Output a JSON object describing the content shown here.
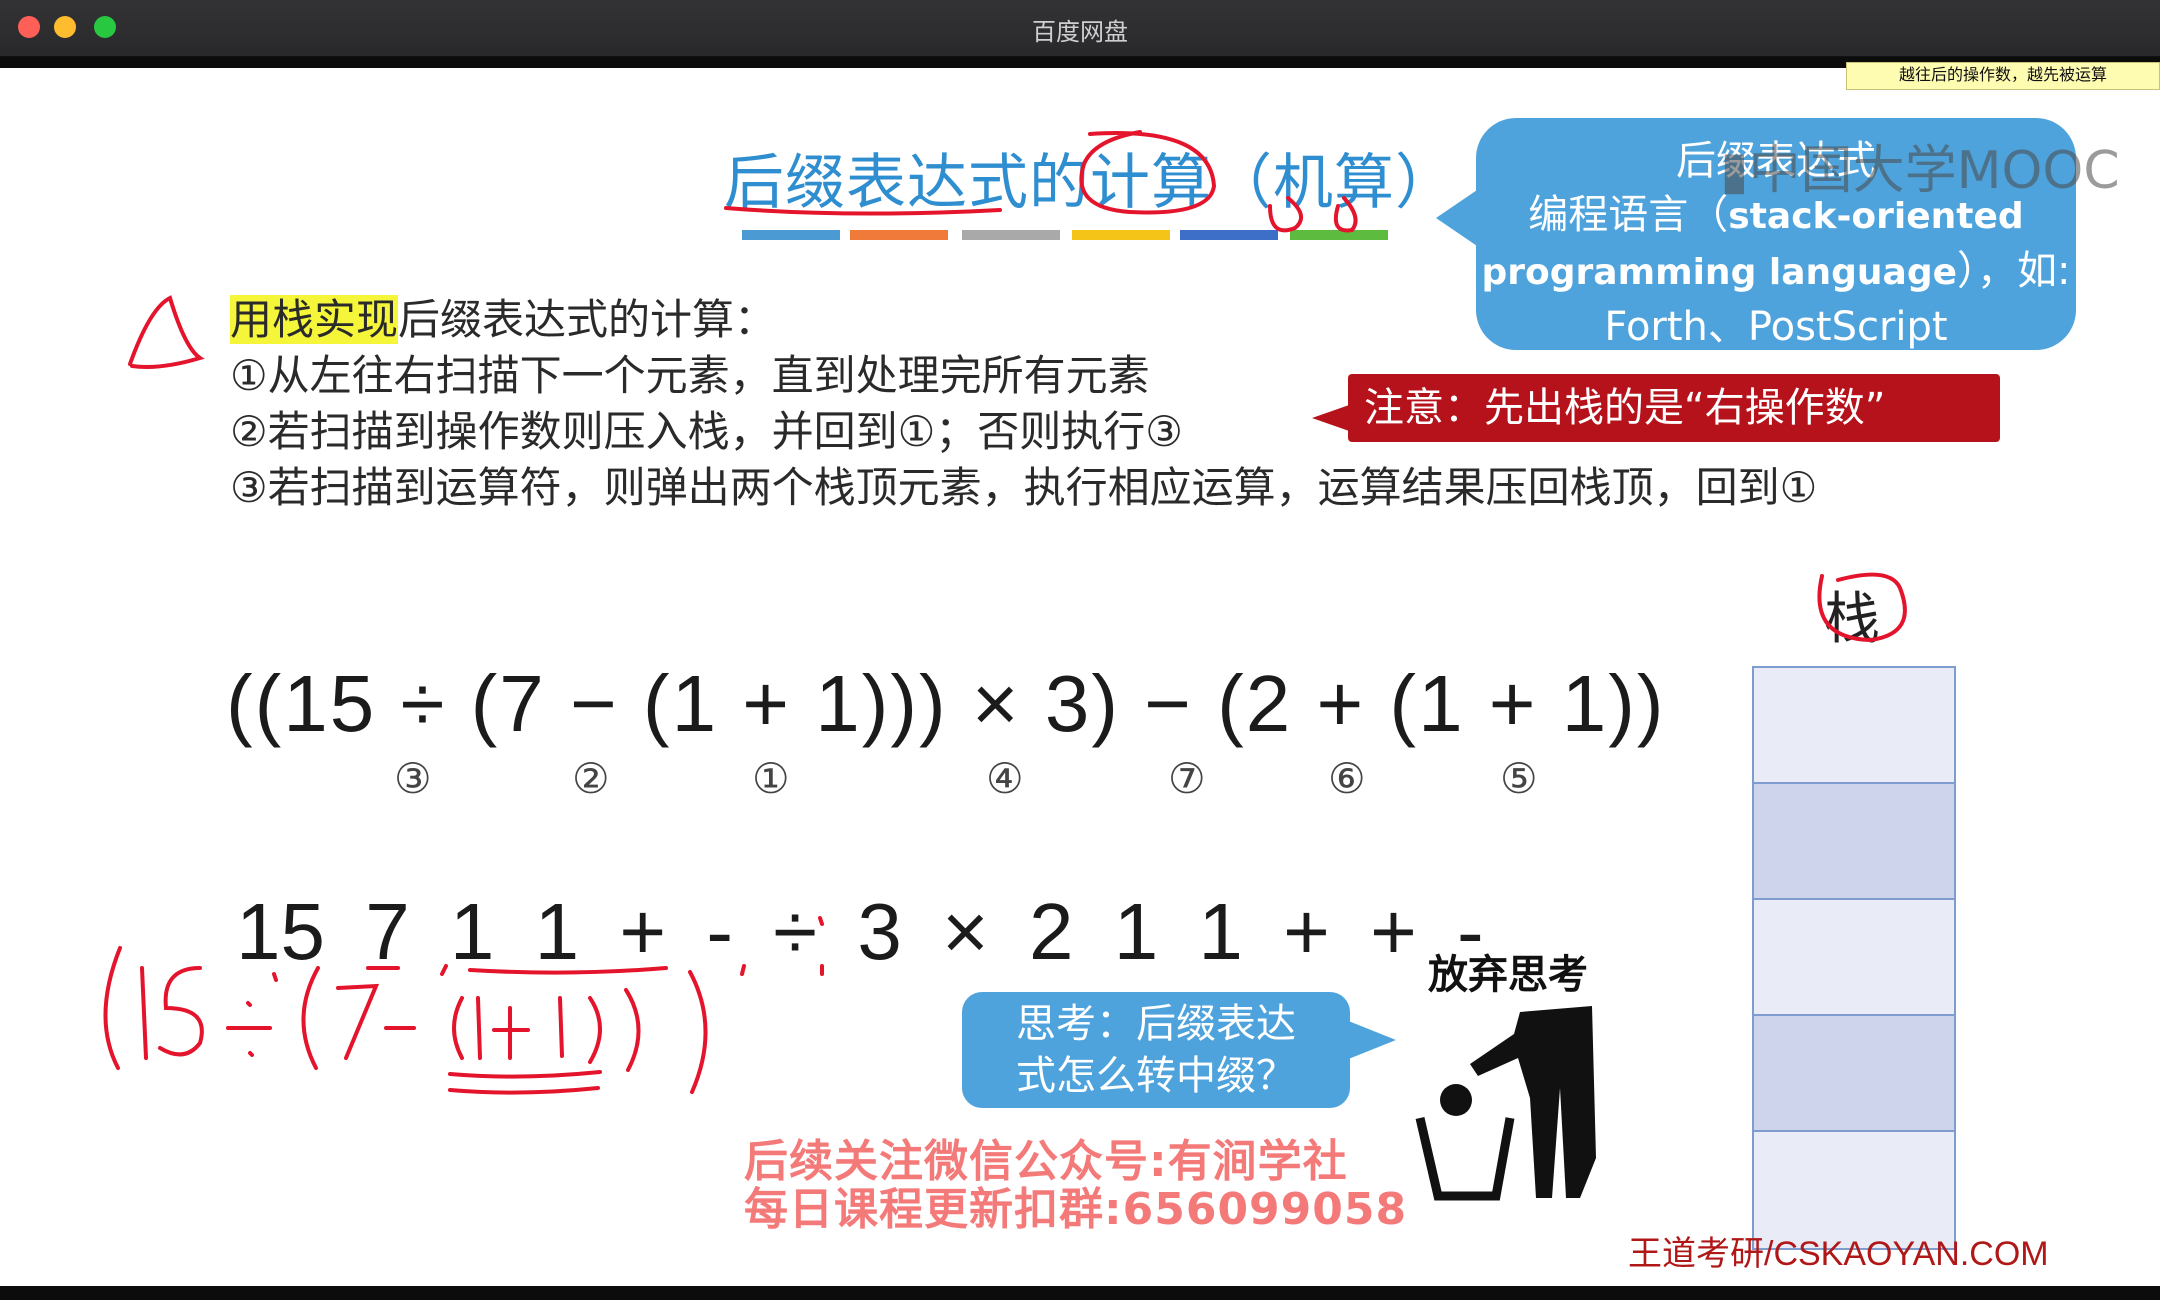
{
  "window": {
    "title": "百度网盘"
  },
  "tooltip": "越往后的操作数，越先被运算",
  "slide": {
    "title": "后缀表达式的计算（机算）",
    "color_bars": [
      "#4b9ad4",
      "#ef7a3a",
      "#a9a9a9",
      "#f4c518",
      "#3e6fc8",
      "#5dbb3f"
    ],
    "bubble_top": {
      "line1": "后缀表达式",
      "line2": "编程语言（",
      "line2b": "stack-oriented",
      "line3": "programming language",
      "line3b": "），如:",
      "line4": "Forth、PostScript"
    },
    "watermark": "中国大学MOOC",
    "rules": {
      "heading_hl": "用栈实现",
      "heading_rest": "后缀表达式的计算：",
      "r1": "①从左往右扫描下一个元素，直到处理完所有元素",
      "r2": "②若扫描到操作数则压入栈，并回到①；否则执行③",
      "r3": "③若扫描到运算符，则弹出两个栈顶元素，执行相应运算，运算结果压回栈顶，回到①"
    },
    "warning": "注意：先出栈的是“右操作数”",
    "infix": "((15 ÷ (7 − (1 + 1))) × 3) − (2 + (1 + 1))",
    "order_marks": [
      "③",
      "②",
      "①",
      "④",
      "⑦",
      "⑥",
      "⑤"
    ],
    "postfix": "15 7 1 1 + - ÷ 3 × 2 1 1 + + -",
    "stack_label": "栈",
    "think_bubble": {
      "line1": "思考：后缀表达",
      "line2": "式怎么转中缀？"
    },
    "give_up": "放弃思考",
    "promo": {
      "line1": "后续关注微信公众号:有涧学社",
      "line2": "每日课程更新扣群:656099058"
    },
    "brand": "王道考研/CSKAOYAN.COM",
    "handwriting": "(15÷(7-(1+1))"
  }
}
